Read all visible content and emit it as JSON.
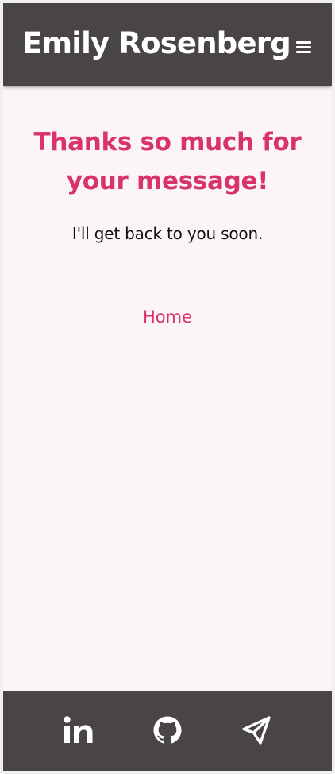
{
  "header": {
    "title": "Emily Rosenberg",
    "menu_icon": "hamburger-menu-icon"
  },
  "main": {
    "heading": "Thanks so much for your message!",
    "message": "I'll get back to you soon.",
    "home_link": "Home"
  },
  "footer": {
    "links": [
      {
        "icon": "linkedin-icon"
      },
      {
        "icon": "github-icon"
      },
      {
        "icon": "paper-plane-icon"
      }
    ]
  },
  "colors": {
    "bar_background": "#494445",
    "page_background": "#fbf5f8",
    "accent": "#d8336a",
    "body_text": "#111111"
  }
}
